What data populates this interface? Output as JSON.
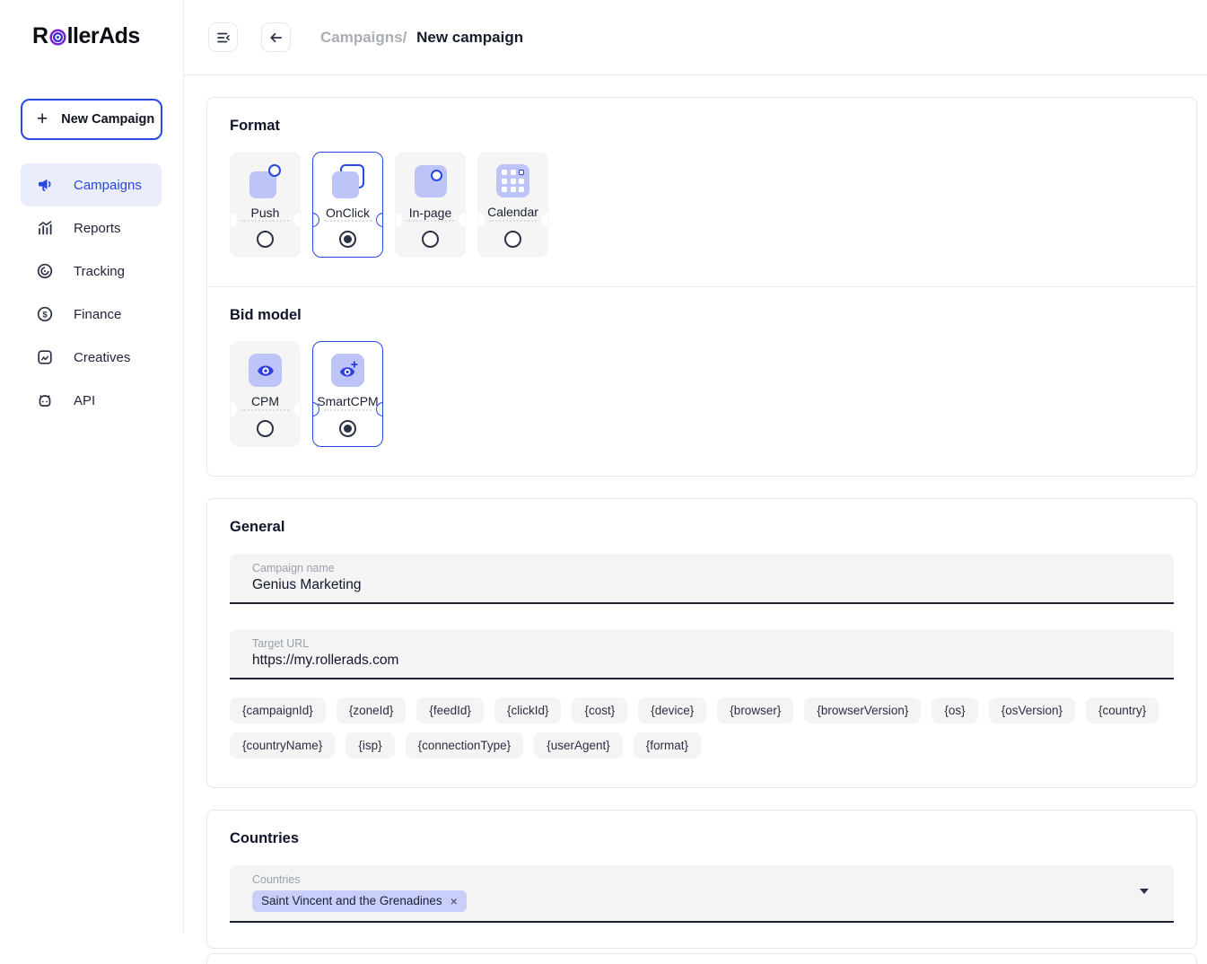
{
  "brand": {
    "logo_r": "R",
    "logo_mid": "ller",
    "logo_end": "Ads"
  },
  "sidebar": {
    "new_campaign": "New Campaign",
    "items": [
      {
        "label": "Campaigns",
        "icon": "megaphone-icon",
        "active": true
      },
      {
        "label": "Reports",
        "icon": "bar-chart-icon",
        "active": false
      },
      {
        "label": "Tracking",
        "icon": "target-disc-icon",
        "active": false
      },
      {
        "label": "Finance",
        "icon": "coin-icon",
        "active": false
      },
      {
        "label": "Creatives",
        "icon": "image-icon",
        "active": false
      },
      {
        "label": "API",
        "icon": "robot-icon",
        "active": false
      }
    ]
  },
  "header": {
    "breadcrumb_parent": "Campaigns/",
    "breadcrumb_current": "New campaign"
  },
  "format": {
    "title": "Format",
    "selected": "OnClick",
    "options": [
      {
        "label": "Push",
        "selected": false
      },
      {
        "label": "OnClick",
        "selected": true
      },
      {
        "label": "In-page",
        "selected": false
      },
      {
        "label": "Calendar",
        "selected": false
      }
    ]
  },
  "bid_model": {
    "title": "Bid model",
    "selected": "SmartCPM",
    "options": [
      {
        "label": "CPM",
        "selected": false
      },
      {
        "label": "SmartCPM",
        "selected": true
      }
    ]
  },
  "general": {
    "title": "General",
    "campaign_name_label": "Campaign name",
    "campaign_name_value": "Genius Marketing",
    "target_url_label": "Target URL",
    "target_url_value": "https://my.rollerads.com",
    "macros": [
      "{campaignId}",
      "{zoneId}",
      "{feedId}",
      "{clickId}",
      "{cost}",
      "{device}",
      "{browser}",
      "{browserVersion}",
      "{os}",
      "{osVersion}",
      "{country}",
      "{countryName}",
      "{isp}",
      "{connectionType}",
      "{userAgent}",
      "{format}"
    ]
  },
  "countries": {
    "title": "Countries",
    "field_label": "Countries",
    "selected_tags": [
      {
        "label": "Saint Vincent and the Grenadines",
        "remove": "×"
      }
    ]
  },
  "colors": {
    "accent": "#2847e4",
    "icon_fill": "#bdc4f8",
    "active_nav_bg": "#e9edfc",
    "input_bg": "#f4f4f5",
    "country_chip_bg": "#c9cffa",
    "dark_text": "#1b2134"
  }
}
